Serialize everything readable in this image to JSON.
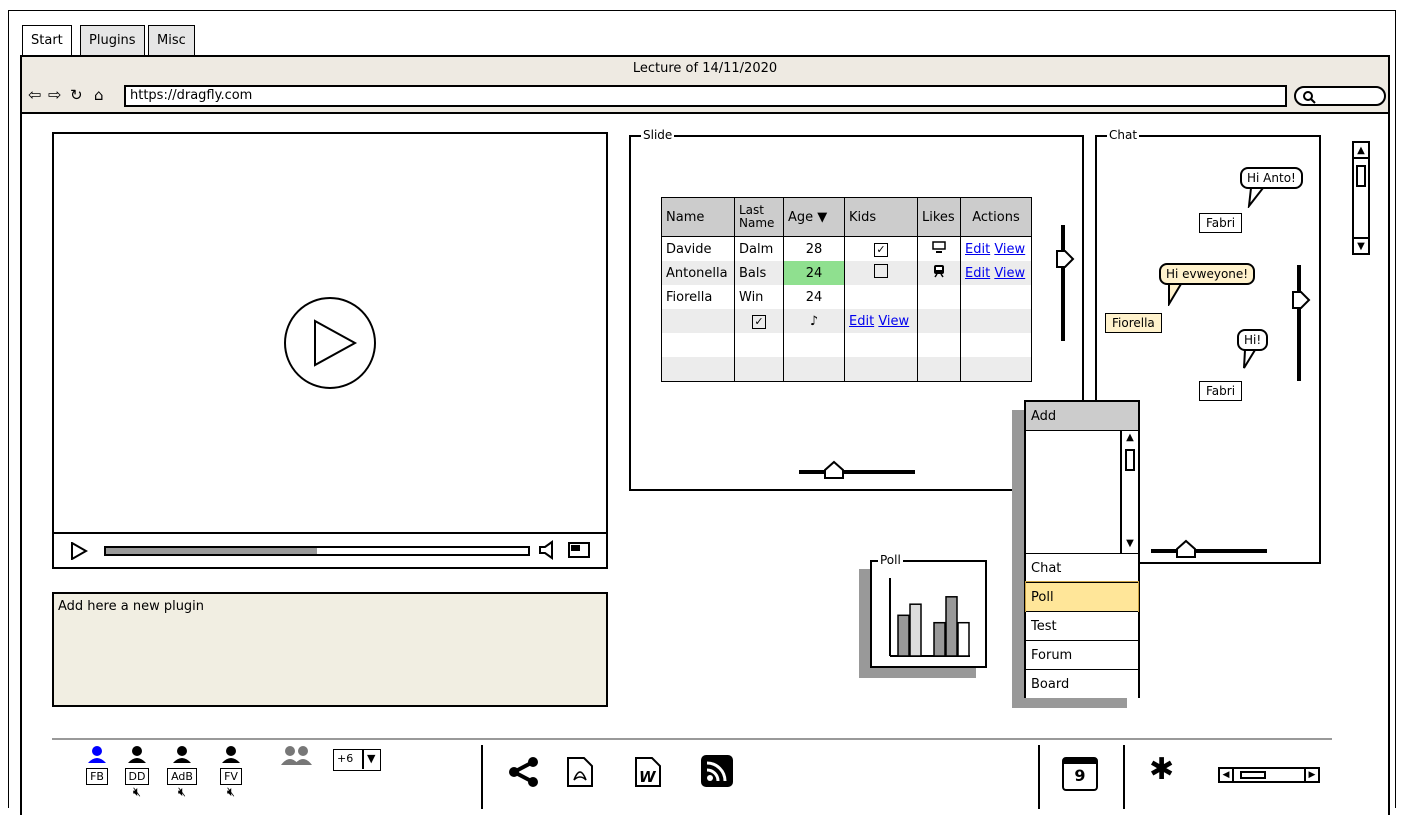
{
  "tabs": [
    "Start",
    "Plugins",
    "Misc"
  ],
  "window_title": "Lecture of 14/11/2020",
  "url": "https://dragfly.com",
  "video": {
    "progress": 0.5
  },
  "plugin_area": {
    "text": "Add here a new plugin"
  },
  "slide": {
    "title": "Slide",
    "table": {
      "headers": [
        "Name",
        "Last Name",
        "Age",
        "Kids",
        "Likes",
        "Actions"
      ],
      "rows": [
        [
          "Davide",
          "Dalm",
          "28",
          "checked",
          "monitor-icon",
          "Edit View"
        ],
        [
          "Antonella",
          "Bals",
          "24",
          "unchecked",
          "train-icon",
          "Edit View"
        ],
        [
          "Fiorella",
          "Win",
          "24",
          "",
          "",
          ""
        ],
        [
          "",
          "checked",
          "music-icon",
          "Edit View",
          "",
          ""
        ],
        [
          "",
          "",
          "",
          "",
          "",
          ""
        ],
        [
          "",
          "",
          "",
          "",
          "",
          ""
        ]
      ],
      "highlight_color": "#8fe08f"
    },
    "edit_label": "Edit",
    "view_label": "View"
  },
  "chat": {
    "title": "Chat",
    "messages": [
      {
        "author": "Fabri",
        "text": "Hi Anto!"
      },
      {
        "author": "Fiorella",
        "text": "Hi evweyone!"
      },
      {
        "author": "Fabri",
        "text": "Hi!"
      }
    ],
    "highlight_color": "#fff2cc"
  },
  "poll": {
    "title": "Poll",
    "values": [
      0.55,
      0.7,
      0.45,
      0.8,
      0.45
    ]
  },
  "add_menu": {
    "title": "Add",
    "items": [
      "Chat",
      "Poll",
      "Test",
      "Forum",
      "Board"
    ],
    "selected": "Poll",
    "selected_color": "#ffe699"
  },
  "users": [
    {
      "initials": "FB",
      "color": "#0000ff",
      "muted": false
    },
    {
      "initials": "DD",
      "color": "#000000",
      "muted": true
    },
    {
      "initials": "AdB",
      "color": "#000000",
      "muted": true
    },
    {
      "initials": "FV",
      "color": "#000000",
      "muted": true
    }
  ],
  "more_users": "+6",
  "calendar_day": "9"
}
